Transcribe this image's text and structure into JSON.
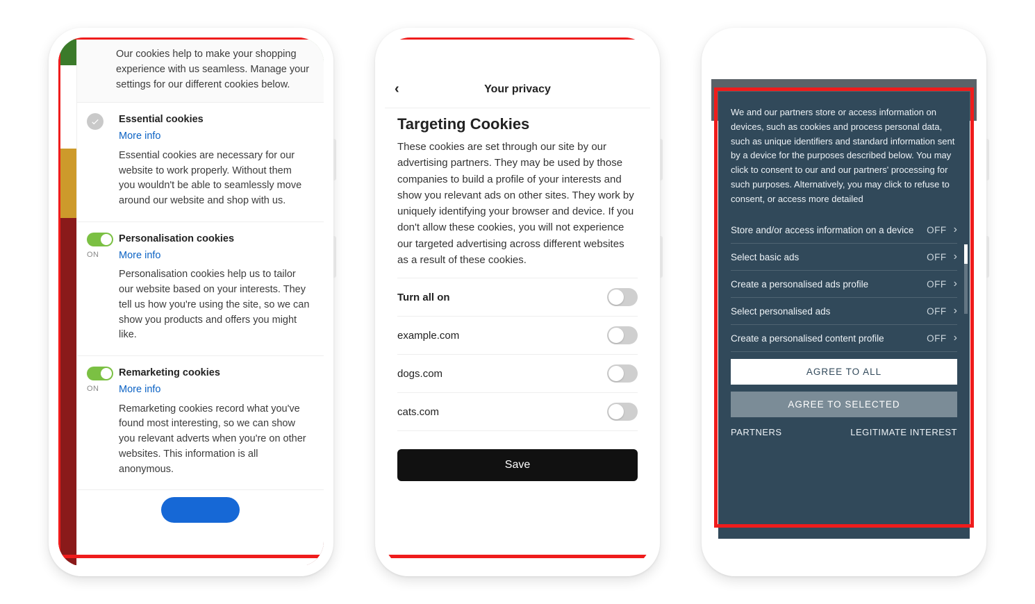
{
  "phone1": {
    "intro": "Our cookies help to make your shopping experience with us seamless. Manage your settings for our different cookies below.",
    "sections": [
      {
        "kind": "check",
        "title": "Essential cookies",
        "more": "More info",
        "body": "Essential cookies are necessary for our website to work properly. Without them you wouldn't be able to seamlessly move around our website and shop with us."
      },
      {
        "kind": "toggle",
        "state": "ON",
        "title": "Personalisation cookies",
        "more": "More info",
        "body": "Personalisation cookies help us to tailor our website based on your interests. They tell us how you're using the site, so we can show you products and offers you might like."
      },
      {
        "kind": "toggle",
        "state": "ON",
        "title": "Remarketing cookies",
        "more": "More info",
        "body": "Remarketing cookies record what you've found most interesting, so we can show you relevant adverts when you're on other websites. This information is all anonymous."
      }
    ]
  },
  "phone2": {
    "header": "Your privacy",
    "heading": "Targeting Cookies",
    "description": "These cookies are set through our site by our advertising partners. They may be used by those companies to build a profile of your interests and show you relevant ads on other sites. They work by uniquely identifying your browser and device. If you don't allow these cookies, you will not experience our targeted advertising across different websites as a result of these cookies.",
    "rows": [
      {
        "label": "Turn all on",
        "bold": true
      },
      {
        "label": "example.com"
      },
      {
        "label": "dogs.com"
      },
      {
        "label": "cats.com"
      }
    ],
    "save": "Save"
  },
  "phone3": {
    "intro": "We and our partners store or access information on devices, such as cookies and process personal data, such as unique identifiers and standard information sent by a device for the purposes described below. You may click to consent to our and our partners' processing for such purposes. Alternatively, you may click to refuse to consent, or access more detailed",
    "rows": [
      {
        "label": "Store and/or access information on a device",
        "state": "OFF"
      },
      {
        "label": "Select basic ads",
        "state": "OFF"
      },
      {
        "label": "Create a personalised ads profile",
        "state": "OFF"
      },
      {
        "label": "Select personalised ads",
        "state": "OFF"
      },
      {
        "label": "Create a personalised content profile",
        "state": "OFF"
      }
    ],
    "agree_all": "AGREE TO ALL",
    "agree_selected": "AGREE TO SELECTED",
    "footer_left": "PARTNERS",
    "footer_right": "LEGITIMATE INTEREST"
  }
}
